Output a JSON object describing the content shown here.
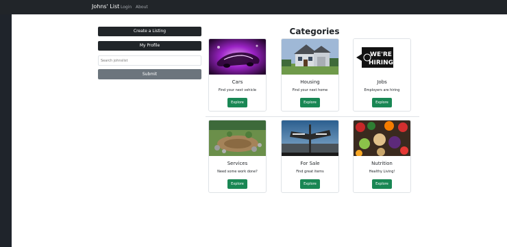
{
  "navbar": {
    "brand": "Johns' List",
    "links": [
      "Login",
      "About"
    ]
  },
  "sidebar": {
    "create_label": "Create a Listing",
    "profile_label": "My Profile",
    "search_placeholder": "Search johnslist",
    "submit_label": "Submit"
  },
  "main": {
    "title": "Categories",
    "explore_label": "Explore",
    "categories": [
      {
        "title": "Cars",
        "text": "Find your next vehicle"
      },
      {
        "title": "Housing",
        "text": "Find your next home"
      },
      {
        "title": "Jobs",
        "text": "Employers are hiring",
        "image_text": [
          "WE'RE",
          "HIRING"
        ]
      },
      {
        "title": "Services",
        "text": "Need some work done?"
      },
      {
        "title": "For Sale",
        "text": "Find great items"
      },
      {
        "title": "Nutrition",
        "text": "Healthy Living!"
      }
    ]
  },
  "colors": {
    "navbar": "#212529",
    "explore_button": "#198754",
    "submit_button": "#6c757d"
  }
}
